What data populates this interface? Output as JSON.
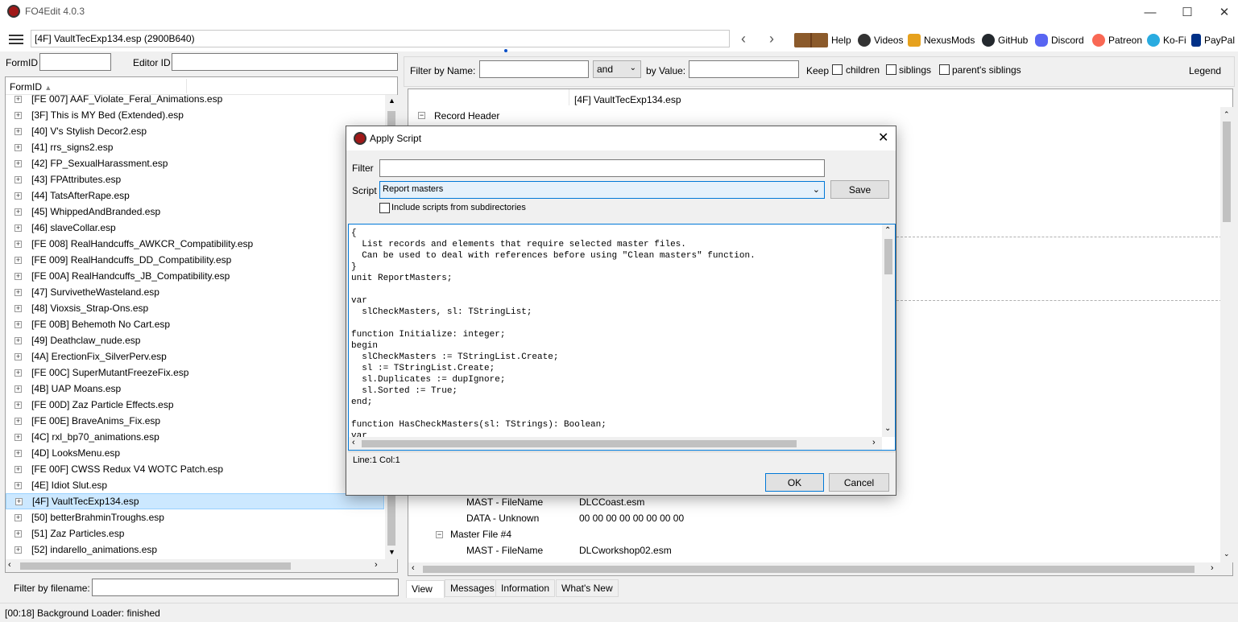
{
  "app": {
    "title": "FO4Edit 4.0.3"
  },
  "toolbar": {
    "path": "[4F] VaultTecExp134.esp (2900B640)",
    "help": "Help",
    "videos": "Videos",
    "nexusmods": "NexusMods",
    "github": "GitHub",
    "discord": "Discord",
    "patreon": "Patreon",
    "kofi": "Ko-Fi",
    "paypal": "PayPal"
  },
  "left": {
    "formid_label": "FormID",
    "editorid_label": "Editor ID",
    "column_header": "FormID",
    "items": [
      "[FE 007] AAF_Violate_Feral_Animations.esp",
      "[3F] This is MY Bed (Extended).esp",
      "[40] V's Stylish Decor2.esp",
      "[41] rrs_signs2.esp",
      "[42] FP_SexualHarassment.esp",
      "[43] FPAttributes.esp",
      "[44] TatsAfterRape.esp",
      "[45] WhippedAndBranded.esp",
      "[46] slaveCollar.esp",
      "[FE 008] RealHandcuffs_AWKCR_Compatibility.esp",
      "[FE 009] RealHandcuffs_DD_Compatibility.esp",
      "[FE 00A] RealHandcuffs_JB_Compatibility.esp",
      "[47] SurvivetheWasteland.esp",
      "[48] Vioxsis_Strap-Ons.esp",
      "[FE 00B] Behemoth No Cart.esp",
      "[49] Deathclaw_nude.esp",
      "[4A] ErectionFix_SilverPerv.esp",
      "[FE 00C] SuperMutantFreezeFix.esp",
      "[4B] UAP Moans.esp",
      "[FE 00D] Zaz Particle Effects.esp",
      "[FE 00E] BraveAnims_Fix.esp",
      "[4C] rxl_bp70_animations.esp",
      "[4D] LooksMenu.esp",
      "[FE 00F] CWSS Redux V4 WOTC Patch.esp",
      "[4E] Idiot Slut.esp",
      "[4F] VaultTecExp134.esp",
      "[50] betterBrahminTroughs.esp",
      "[51] Zaz Particles.esp",
      "[52] indarello_animations.esp"
    ],
    "filter_label": "Filter by filename:"
  },
  "right": {
    "filter_name_label": "Filter by Name:",
    "and_select": "and",
    "by_value_label": "by Value:",
    "keep_label": "Keep",
    "children_label": "children",
    "siblings_label": "siblings",
    "parents_label": "parent's siblings",
    "legend_label": "Legend",
    "header_value": "[4F] VaultTecExp134.esp",
    "record_header": "Record Header",
    "rows": [
      {
        "label": "MAST - FileName",
        "value": "DLCCoast.esm"
      },
      {
        "label": "DATA - Unknown",
        "value": "00 00 00 00 00 00 00 00"
      },
      {
        "label": "Master File #4",
        "value": ""
      },
      {
        "label": "MAST - FileName",
        "value": "DLCworkshop02.esm"
      }
    ],
    "tabs": [
      "View",
      "Messages",
      "Information",
      "What's New"
    ]
  },
  "status": {
    "text": "[00:18] Background Loader: finished"
  },
  "dialog": {
    "title": "Apply Script",
    "filter_label": "Filter",
    "script_label": "Script",
    "script_value": "Report masters",
    "save_label": "Save",
    "include_label": "Include scripts from subdirectories",
    "code": "{\n  List records and elements that require selected master files.\n  Can be used to deal with references before using \"Clean masters\" function.\n}\nunit ReportMasters;\n\nvar\n  slCheckMasters, sl: TStringList;\n\nfunction Initialize: integer;\nbegin\n  slCheckMasters := TStringList.Create;\n  sl := TStringList.Create;\n  sl.Duplicates := dupIgnore;\n  sl.Sorted := True;\nend;\n\nfunction HasCheckMasters(sl: TStrings): Boolean;\nvar",
    "position": "Line:1 Col:1",
    "ok_label": "OK",
    "cancel_label": "Cancel"
  }
}
